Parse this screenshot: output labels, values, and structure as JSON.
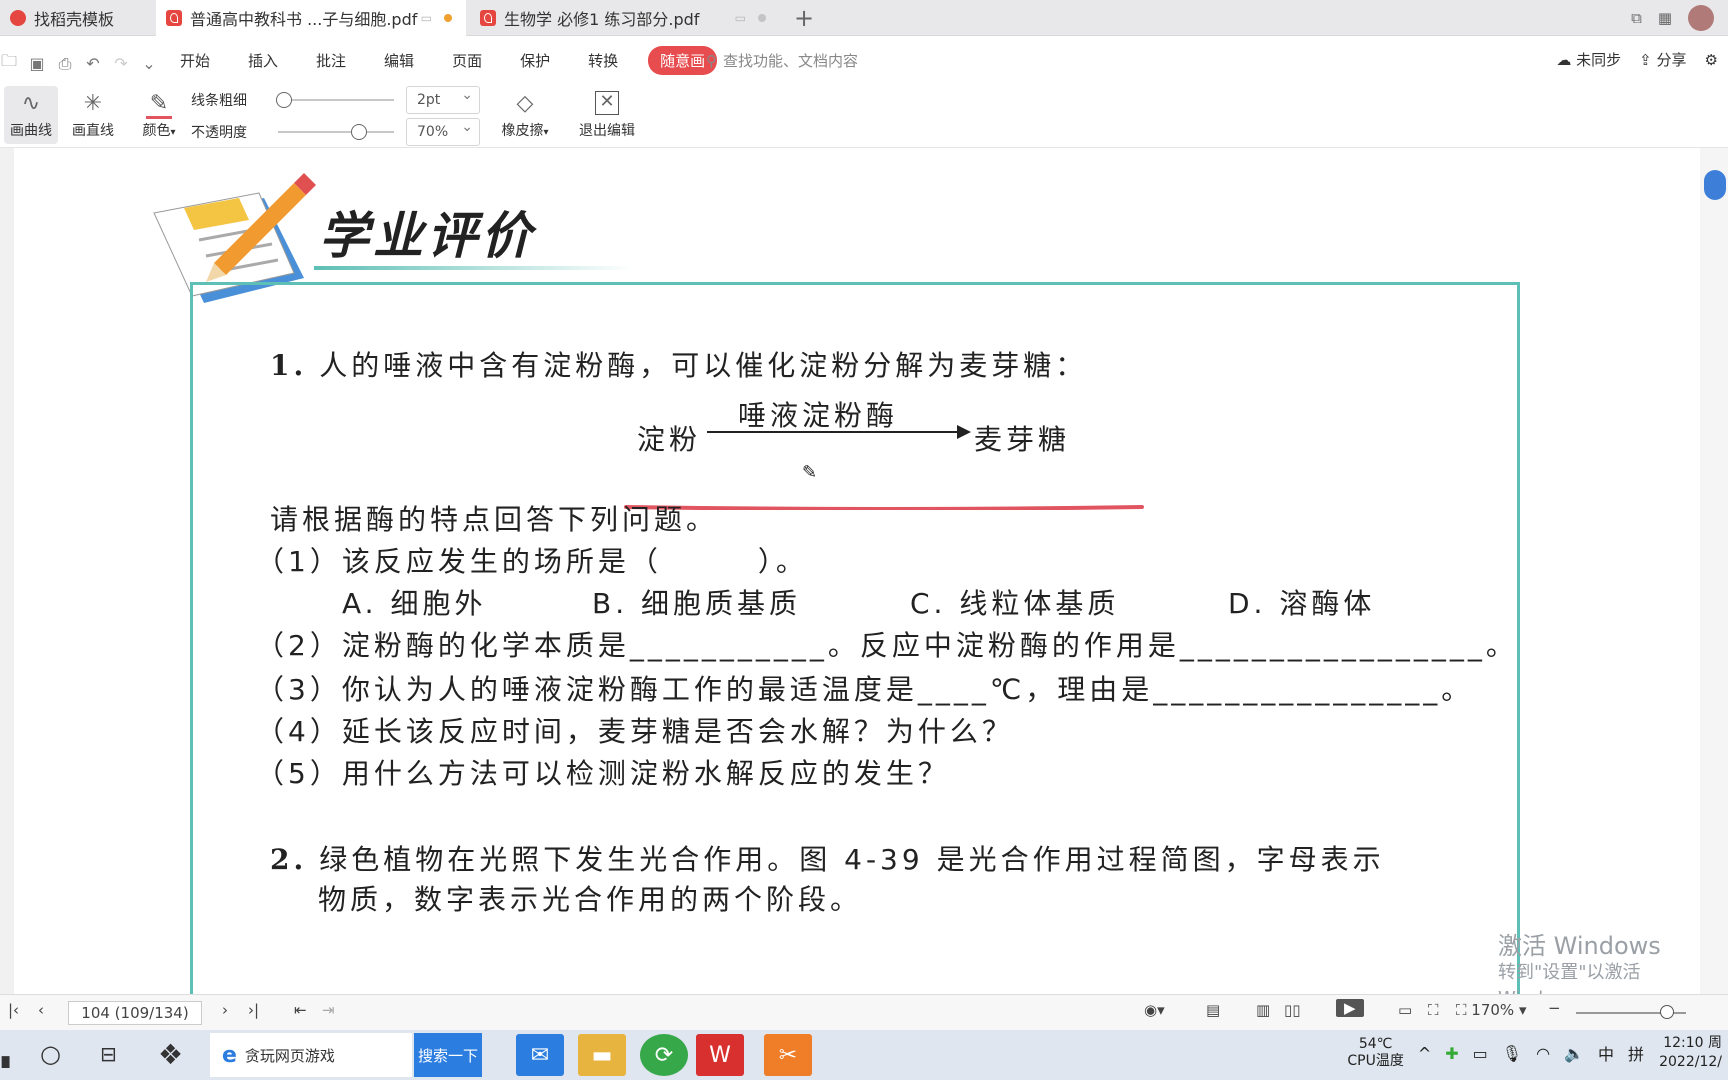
{
  "tabs": [
    {
      "label": "找稻壳模板",
      "active": false
    },
    {
      "label": "普通高中教科书 ...子与细胞.pdf",
      "active": true
    },
    {
      "label": "生物学 必修1 练习部分.pdf",
      "active": false
    }
  ],
  "menu": {
    "items": [
      "开始",
      "插入",
      "批注",
      "编辑",
      "页面",
      "保护",
      "转换"
    ],
    "highlight": "随意画",
    "search_placeholder": "查找功能、文档内容",
    "sync": "未同步",
    "share": "分享"
  },
  "toolbar": {
    "curve": "画曲线",
    "line": "画直线",
    "color": "颜色",
    "thickness_label": "线条粗细",
    "thickness_value": "2pt",
    "opacity_label": "不透明度",
    "opacity_value": "70%",
    "opacity_level": 0.7,
    "eraser": "橡皮擦",
    "exit": "退出编辑"
  },
  "doc": {
    "heading": "学业评价",
    "q1": {
      "num": "1.",
      "text": "人的唾液中含有淀粉酶，可以催化淀粉分解为麦芽糖："
    },
    "reaction": {
      "left": "淀粉",
      "enzyme": "唾液淀粉酶",
      "right": "麦芽糖"
    },
    "prompt": "请根据酶的特点回答下列问题。",
    "subs": [
      "（1）该反应发生的场所是（　　　）。",
      "（2）淀粉酶的化学本质是___________。反应中淀粉酶的作用是_________________。",
      "（3）你认为人的唾液淀粉酶工作的最适温度是____℃，理由是________________。",
      "（4）延长该反应时间，麦芽糖是否会水解？为什么？",
      "（5）用什么方法可以检测淀粉水解反应的发生？"
    ],
    "options": [
      "A. 细胞外",
      "B. 细胞质基质",
      "C. 线粒体基质",
      "D. 溶酶体"
    ],
    "q2": {
      "num": "2.",
      "line1": "绿色植物在光照下发生光合作用。图 4-39 是光合作用过程简图，字母表示",
      "line2": "物质，数字表示光合作用的两个阶段。"
    },
    "watermark1": "激活 Windows",
    "watermark2": "转到\"设置\"以激活 Windows。"
  },
  "status": {
    "page": "104 (109/134)",
    "zoom": "170%"
  },
  "taskbar": {
    "search_text": "贪玩网页游戏",
    "search_button": "搜索一下",
    "temp": "54℃",
    "temp_label": "CPU温度",
    "ime1": "中",
    "ime2": "拼",
    "time": "12:10 周",
    "date": "2022/12/"
  },
  "colors": {
    "accent": "#e74c4f",
    "frame": "#5dbfb5",
    "pen": "#e05560"
  }
}
